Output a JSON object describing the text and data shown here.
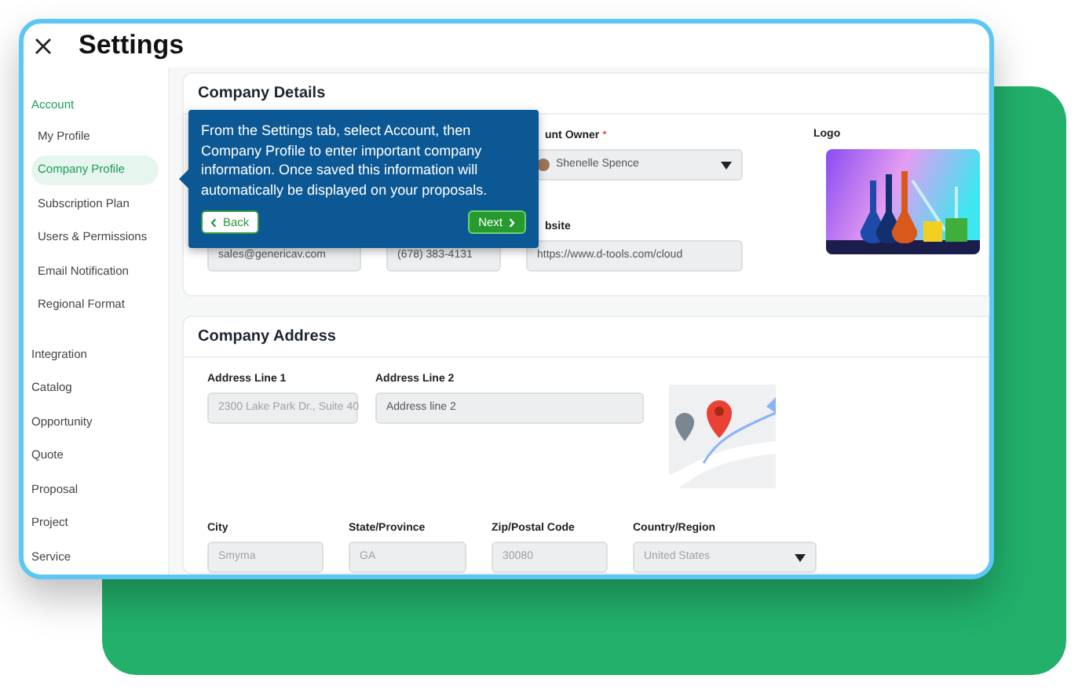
{
  "window": {
    "title": "Settings"
  },
  "sidebar": {
    "section": "Account",
    "account_items": [
      {
        "label": "My Profile",
        "selected": false
      },
      {
        "label": "Company Profile",
        "selected": true
      },
      {
        "label": "Subscription Plan",
        "selected": false
      },
      {
        "label": "Users & Permissions",
        "selected": false
      },
      {
        "label": "Email Notification",
        "selected": false
      },
      {
        "label": "Regional Format",
        "selected": false
      }
    ],
    "items": [
      {
        "label": "Integration",
        "selected": false
      },
      {
        "label": "Catalog",
        "selected": false
      },
      {
        "label": "Opportunity",
        "selected": false
      },
      {
        "label": "Quote",
        "selected": false
      },
      {
        "label": "Proposal",
        "selected": false
      },
      {
        "label": "Project",
        "selected": false
      },
      {
        "label": "Service",
        "selected": false
      }
    ]
  },
  "company_details": {
    "title": "Company Details",
    "rows": [
      [
        "",
        "",
        {
          "kind": "select",
          "label": "unt Owner",
          "required_mark": "*",
          "value": "Shenelle Spence",
          "avatar": true
        }
      ],
      [
        {
          "kind": "text",
          "value": "sales@genericav.com"
        },
        {
          "kind": "text",
          "value": "(678) 383-4131"
        },
        {
          "kind": "text",
          "label": "bsite",
          "value": "https://www.d-tools.com/cloud"
        }
      ]
    ],
    "logo": {
      "label": "Logo",
      "kind": "picture"
    }
  },
  "company_address": {
    "title": "Company Address",
    "row_1": [
      {
        "kind": "text",
        "label": "Address Line 1",
        "value": "2300 Lake Park Dr., Suite 40",
        "disabled": true
      },
      {
        "kind": "text",
        "label": "Address Line 2",
        "value": "Address line 2",
        "disabled": false
      }
    ],
    "row_2": [
      {
        "kind": "text",
        "label": "City",
        "value": "Smyma",
        "disabled": true
      },
      {
        "kind": "text",
        "label": "State/Province",
        "value": "GA",
        "disabled": true
      },
      {
        "kind": "text",
        "label": "Zip/Postal Code",
        "value": "30080",
        "disabled": true
      },
      {
        "kind": "select",
        "label": "Country/Region",
        "value": "United States",
        "disabled": true
      }
    ]
  },
  "tour_tip": {
    "text": "From the Settings tab, select Account, then Company Profile to enter important company information. Once saved this information will automatically be displayed on your proposals.",
    "back": "Back",
    "next": "Next"
  }
}
